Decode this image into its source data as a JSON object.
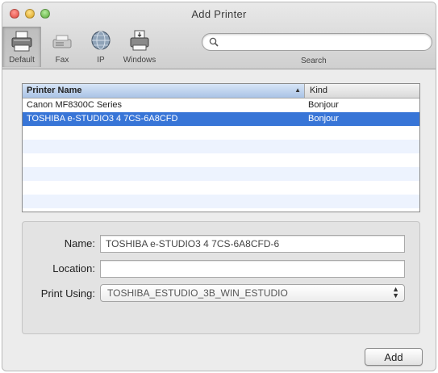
{
  "window": {
    "title": "Add Printer"
  },
  "toolbar": {
    "items": [
      {
        "label": "Default",
        "icon": "default-printer-icon",
        "selected": true
      },
      {
        "label": "Fax",
        "icon": "fax-icon",
        "selected": false
      },
      {
        "label": "IP",
        "icon": "ip-globe-icon",
        "selected": false
      },
      {
        "label": "Windows",
        "icon": "windows-printer-icon",
        "selected": false
      }
    ],
    "search": {
      "placeholder": "",
      "label": "Search"
    }
  },
  "printer_list": {
    "columns": {
      "name": "Printer Name",
      "kind": "Kind"
    },
    "sort_indicator": "▲",
    "rows": [
      {
        "name": "Canon MF8300C Series",
        "kind": "Bonjour"
      },
      {
        "name": "TOSHIBA e-STUDIO3 4 7CS-6A8CFD",
        "kind": "Bonjour"
      }
    ],
    "selected_index": 1
  },
  "details": {
    "name_label": "Name:",
    "name_value": "TOSHIBA e-STUDIO3 4 7CS-6A8CFD-6",
    "location_label": "Location:",
    "location_value": "",
    "print_using_label": "Print Using:",
    "print_using_value": "TOSHIBA_ESTUDIO_3B_WIN_ESTUDIO"
  },
  "actions": {
    "add_label": "Add"
  },
  "colors": {
    "selection": "#3875d7",
    "close_light": "#e0443b",
    "minimize_light": "#d9a11c",
    "zoom_light": "#56a836"
  }
}
